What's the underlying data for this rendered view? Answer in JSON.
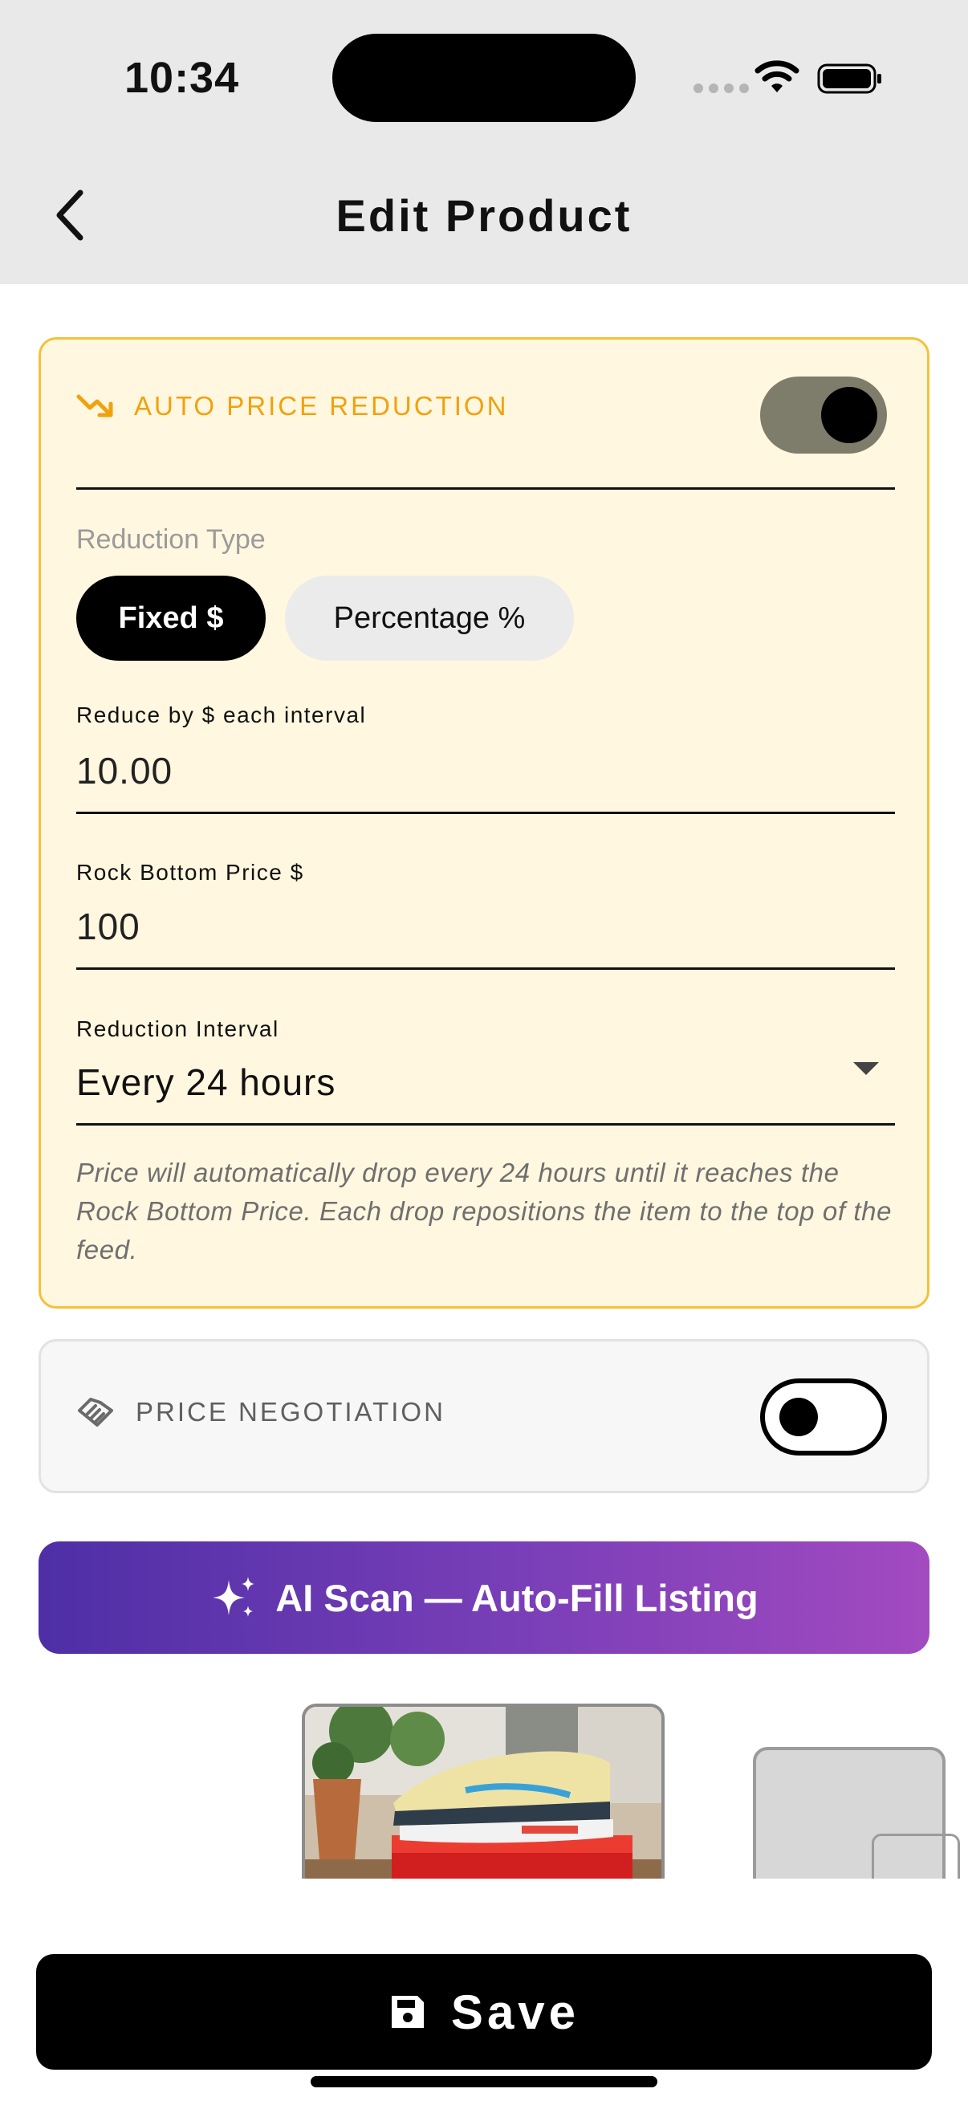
{
  "status_bar": {
    "time": "10:34"
  },
  "header": {
    "title": "Edit Product"
  },
  "auto_price_reduction": {
    "label": "AUTO PRICE REDUCTION",
    "enabled": true,
    "icon": "trending-down-icon",
    "accent_color": "#f0a20e",
    "reduction_type_label": "Reduction Type",
    "types": [
      "Fixed $",
      "Percentage %"
    ],
    "selected_type": "Fixed $",
    "reduce_by_label": "Reduce by $ each interval",
    "reduce_by_value": "10.00",
    "rock_bottom_label": "Rock Bottom Price $",
    "rock_bottom_value": "100",
    "interval_label": "Reduction Interval",
    "interval_value": "Every 24 hours",
    "help_text": "Price will automatically drop every 24 hours until it reaches the Rock Bottom Price. Each drop repositions the item to the top of the feed."
  },
  "price_negotiation": {
    "label": "PRICE NEGOTIATION",
    "enabled": false,
    "icon": "handshake-icon"
  },
  "ai_scan": {
    "label": "AI Scan — Auto-Fill Listing",
    "icon": "sparkles-icon"
  },
  "photos": {
    "main": "sneaker-photo",
    "secondary": "empty-photo-slot"
  },
  "save": {
    "label": "Save",
    "icon": "floppy-disk-icon"
  }
}
